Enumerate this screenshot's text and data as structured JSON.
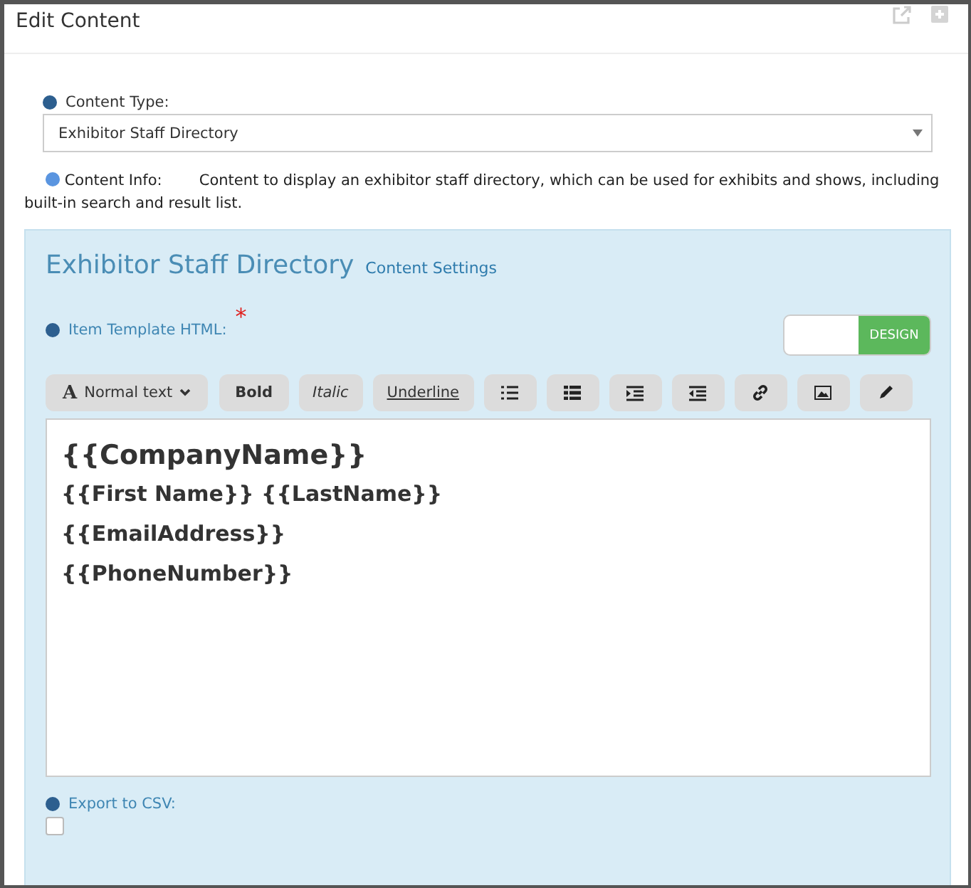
{
  "window": {
    "title": "Edit Content"
  },
  "content_type": {
    "label": "Content Type:",
    "value": "Exhibitor Staff Directory"
  },
  "content_info": {
    "label": "Content Info:",
    "text": "Content to display an exhibitor staff directory, which can be used for exhibits and shows, including built-in search and result list."
  },
  "panel": {
    "title": "Exhibitor Staff Directory",
    "link": "Content Settings"
  },
  "template": {
    "label": "Item Template HTML:",
    "required_mark": "*"
  },
  "mode_toggle": {
    "label": "DESIGN",
    "on": true
  },
  "toolbar": [
    {
      "kind": "style",
      "glyph": "A",
      "label": "Normal text"
    },
    {
      "kind": "bold",
      "label": "Bold"
    },
    {
      "kind": "italic",
      "label": "Italic"
    },
    {
      "kind": "underline",
      "label": "Underline"
    },
    {
      "kind": "bullet-list"
    },
    {
      "kind": "block-list"
    },
    {
      "kind": "indent"
    },
    {
      "kind": "outdent"
    },
    {
      "kind": "link"
    },
    {
      "kind": "image"
    },
    {
      "kind": "pencil"
    }
  ],
  "editor_lines": [
    {
      "kind": "heading",
      "text": "{{CompanyName}}"
    },
    {
      "kind": "line",
      "text": "{{First Name}} {{LastName}}"
    },
    {
      "kind": "line",
      "text": "{{EmailAddress}}"
    },
    {
      "kind": "line",
      "text": "{{PhoneNumber}}"
    }
  ],
  "export_csv": {
    "label": "Export to CSV:",
    "checked": false
  }
}
